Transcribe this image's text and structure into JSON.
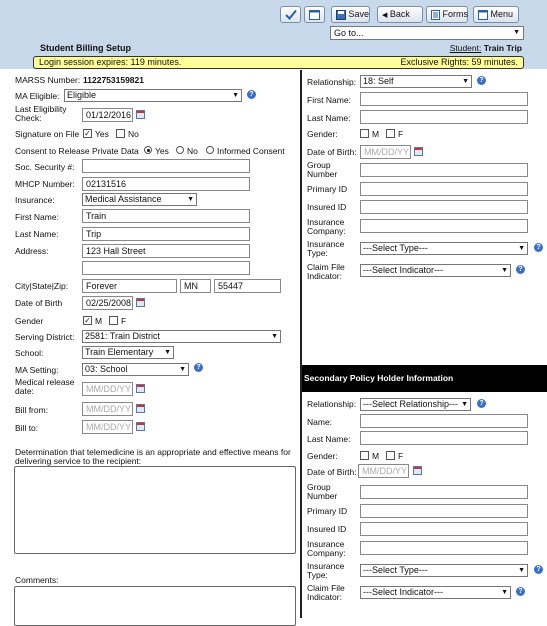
{
  "toolbar": {
    "save_label": "Save",
    "back_label": "Back",
    "forms_label": "Forms",
    "menu_label": "Menu",
    "goto_value": "Go to..."
  },
  "header": {
    "title": "Student Billing Setup",
    "student_link": "Student:",
    "student_name": "Train Trip",
    "session_text": "Login session expires: 119 minutes.",
    "exclusive_text": "Exclusive Rights: 59 minutes."
  },
  "left": {
    "marss_label": "MARSS Number:",
    "marss_value": "1122753159821",
    "ma_eligible_label": "MA Eligible:",
    "ma_eligible_value": "Eligible",
    "last_elig_label": "Last Eligibility Check:",
    "last_elig_value": "01/12/2016",
    "sig_label": "Signature on File",
    "sig_yes": "Yes",
    "sig_no": "No",
    "consent_label": "Consent to Release Private Data",
    "consent_yes": "Yes",
    "consent_no": "No",
    "consent_informed": "Informed Consent",
    "ssn_label": "Soc. Security #:",
    "ssn_value": "",
    "mhcp_label": "MHCP Number:",
    "mhcp_value": "02131516",
    "insurance_label": "Insurance:",
    "insurance_value": "Medical Assistance",
    "first_label": "First Name:",
    "first_value": "Train",
    "last_label": "Last Name:",
    "last_value": "Trip",
    "address_label": "Address:",
    "address_value": "123 Hall Street",
    "address2_value": "",
    "csz_label": "City|State|Zip:",
    "city_value": "Forever",
    "state_value": "MN",
    "zip_value": "55447",
    "dob_label": "Date of Birth",
    "dob_value": "02/25/2008",
    "gender_label": "Gender",
    "gender_m": "M",
    "gender_f": "F",
    "district_label": "Serving District:",
    "district_value": "2581: Train District",
    "school_label": "School:",
    "school_value": "Train Elementary",
    "setting_label": "MA Setting:",
    "setting_value": "03: School",
    "medrel_label": "Medical release date:",
    "date_placeholder": "MM/DD/YY",
    "billfrom_label": "Bill from:",
    "billto_label": "Bill to:",
    "tele_label": "Determination that telemedicine is an appropriate and effective means for delivering service to the recipient:",
    "comments_label": "Comments:"
  },
  "primary": {
    "relationship_label": "Relationship:",
    "relationship_value": "18: Self",
    "first_label": "First Name:",
    "last_label": "Last Name:",
    "gender_label": "Gender:",
    "gender_m": "M",
    "gender_f": "F",
    "dob_label": "Date of Birth:",
    "dob_placeholder": "MM/DD/YY",
    "group_label": "Group Number",
    "primary_id_label": "Primary ID",
    "insured_id_label": "Insured ID",
    "ins_company_label": "Insurance Company:",
    "ins_type_label": "Insurance Type:",
    "ins_type_value": "---Select Type---",
    "claim_label": "Claim File Indicator:",
    "claim_value": "---Select Indicator---"
  },
  "secondary": {
    "section_title": "Secondary Policy Holder Information",
    "relationship_label": "Relationship:",
    "relationship_value": "---Select Relationship---",
    "name_label": "Name:",
    "last_label": "Last Name:",
    "gender_label": "Gender:",
    "gender_m": "M",
    "gender_f": "F",
    "dob_label": "Date of Birth:",
    "dob_placeholder": "MM/DD/YY",
    "group_label": "Group Number",
    "primary_id_label": "Primary ID",
    "insured_id_label": "Insured ID",
    "ins_company_label": "Insurance Company:",
    "ins_type_label": "Insurance Type:",
    "ins_type_value": "---Select Type---",
    "claim_label": "Claim File Indicator:",
    "claim_value": "---Select Indicator---"
  }
}
